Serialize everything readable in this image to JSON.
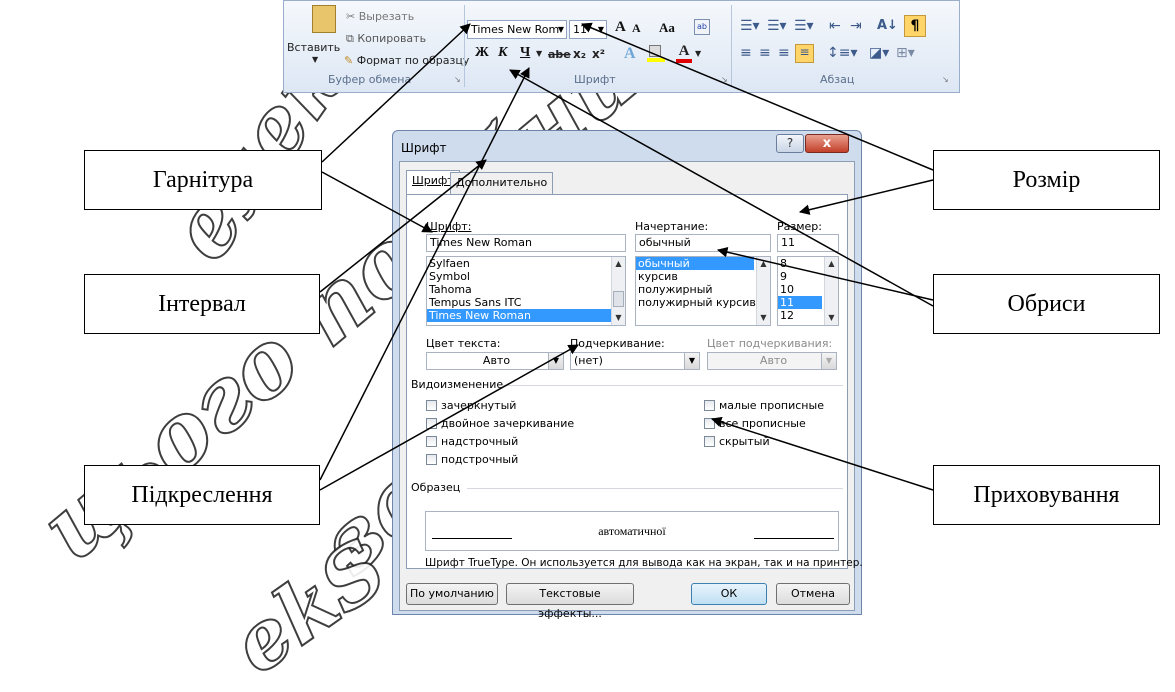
{
  "watermark": [
    "цього посібника",
    "заборонено",
    "електронного",
    "ekS"
  ],
  "ribbon": {
    "clipboard": {
      "paste": "Вставить",
      "cut": "Вырезать",
      "copy": "Копировать",
      "format_painter": "Формат по образцу",
      "group_label": "Буфер обмена"
    },
    "font": {
      "font_name": "Times New Rom",
      "font_size": "11",
      "bold": "Ж",
      "italic": "К",
      "underline": "Ч",
      "strike": "abe",
      "subscript": "x₂",
      "superscript": "x²",
      "grow": "A",
      "shrink": "A",
      "change_case": "Aa",
      "group_label": "Шрифт"
    },
    "paragraph": {
      "group_label": "Абзац",
      "pilcrow": "¶"
    }
  },
  "dialog": {
    "title": "Шрифт",
    "help": "?",
    "close": "x",
    "tabs": [
      "Шрифт",
      "Дополнительно"
    ],
    "font_label": "Шрифт:",
    "font_value": "Times New Roman",
    "font_list": [
      "Sylfaen",
      "Symbol",
      "Tahoma",
      "Tempus Sans ITC",
      "Times New Roman"
    ],
    "style_label": "Начертание:",
    "style_value": "обычный",
    "style_list": [
      "обычный",
      "курсив",
      "полужирный",
      "полужирный курсив"
    ],
    "size_label": "Размер:",
    "size_value": "11",
    "size_list": [
      "8",
      "9",
      "10",
      "11",
      "12"
    ],
    "text_color_label": "Цвет текста:",
    "text_color_value": "Авто",
    "underline_label": "Подчеркивание:",
    "underline_value": "(нет)",
    "underline_color_label": "Цвет подчеркивания:",
    "underline_color_value": "Авто",
    "effects_label": "Видоизменение",
    "effects_left": [
      "зачеркнутый",
      "двойное зачеркивание",
      "надстрочный",
      "подстрочный"
    ],
    "effects_right": [
      "малые прописные",
      "все прописные",
      "скрытый"
    ],
    "sample_label": "Образец",
    "sample_text": "автоматичної",
    "note": "Шрифт TrueType. Он используется для вывода как на экран, так и на принтер.",
    "btn_default": "По умолчанию",
    "btn_effects": "Текстовые эффекты...",
    "btn_ok": "ОК",
    "btn_cancel": "Отмена"
  },
  "callouts": {
    "typeface": "Гарнітура",
    "size": "Розмір",
    "spacing": "Інтервал",
    "outlines": "Обриси",
    "underline": "Підкреслення",
    "hidden": "Приховування"
  },
  "colors": {
    "selection": "#3399ff",
    "ribbon_bg": "#dde7f4",
    "dialog_frame": "#cfdcee",
    "close_button": "#c2402a"
  }
}
